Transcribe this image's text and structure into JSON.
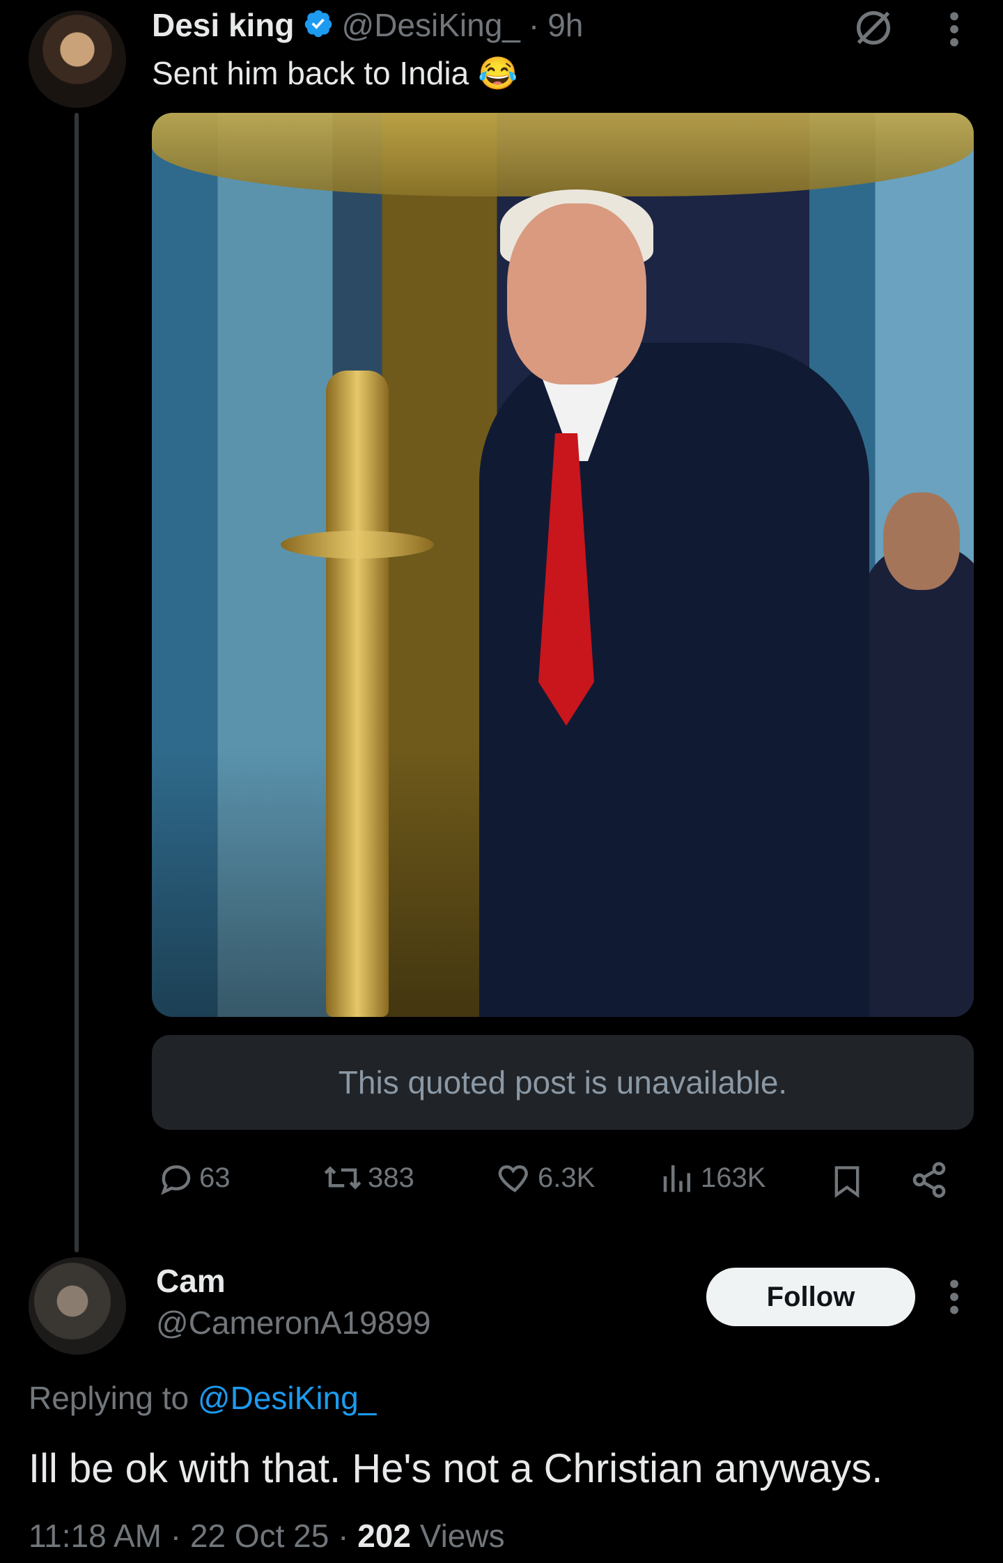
{
  "tweet": {
    "author_name": "Desi king",
    "handle": "@DesiKing_",
    "separator": "·",
    "time": "9h",
    "text": "Sent him back to India",
    "emoji": "😂",
    "quoted_notice": "This quoted post is unavailable.",
    "stats": {
      "replies": "63",
      "reposts": "383",
      "likes": "6.3K",
      "views": "163K"
    }
  },
  "reply": {
    "author_name": "Cam",
    "handle": "@CameronA19899",
    "follow_label": "Follow",
    "replying_prefix": "Replying to",
    "replying_to": "@DesiKing_",
    "text": "Ill be ok with that. He's not a Christian anyways.",
    "time": "11:18 AM",
    "date": "22 Oct 25",
    "views_count": "202",
    "views_label": "Views",
    "dot": "·"
  },
  "colors": {
    "accent": "#1d9bf0",
    "background": "#000000",
    "muted": "#71767b",
    "text": "#e7e9ea"
  }
}
